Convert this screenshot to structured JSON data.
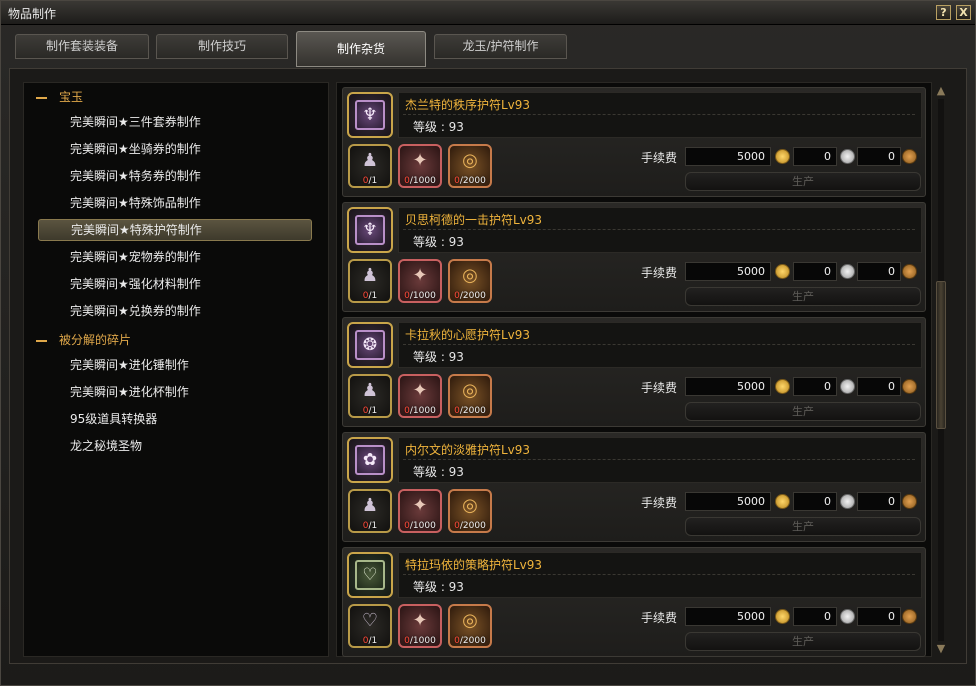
{
  "window": {
    "title": "物品制作",
    "help_label": "?",
    "close_label": "X"
  },
  "tabs": [
    {
      "label": "制作套装装备"
    },
    {
      "label": "制作技巧"
    },
    {
      "label": "制作杂货"
    },
    {
      "label": "龙玉/护符制作"
    }
  ],
  "active_tab": "制作杂货",
  "categories": [
    {
      "label": "宝玉",
      "expanded": true,
      "items": [
        "完美瞬间★三件套券制作",
        "完美瞬间★坐骑券的制作",
        "完美瞬间★特务券的制作",
        "完美瞬间★特殊饰品制作",
        "完美瞬间★特殊护符制作",
        "完美瞬间★宠物券的制作",
        "完美瞬间★强化材料制作",
        "完美瞬间★兑换券的制作"
      ]
    },
    {
      "label": "被分解的碎片",
      "expanded": true,
      "items": [
        "完美瞬间★进化锤制作",
        "完美瞬间★进化杯制作",
        "95级道具转换器",
        "龙之秘境圣物"
      ]
    }
  ],
  "selected_item": "完美瞬间★特殊护符制作",
  "fee_label": "手续费",
  "produce_label": "生产",
  "recipes": [
    {
      "name": "杰兰特的秩序护符Lv93",
      "level": "等级 : 93",
      "icon": "purple-sword-charm-icon",
      "materials": [
        {
          "icon": "dark-charm-material-icon",
          "have": "0",
          "need": "/1"
        },
        {
          "icon": "red-fragment-material-icon",
          "have": "0",
          "need": "/1000"
        },
        {
          "icon": "gold-ring-material-icon",
          "have": "0",
          "need": "/2000"
        }
      ],
      "fee_gold": "5000",
      "fee_silver": "0",
      "fee_bronze": "0"
    },
    {
      "name": "贝思柯德的一击护符Lv93",
      "level": "等级 : 93",
      "icon": "purple-sword-charm-icon",
      "materials": [
        {
          "icon": "dark-charm-material-icon",
          "have": "0",
          "need": "/1"
        },
        {
          "icon": "red-fragment-material-icon",
          "have": "0",
          "need": "/1000"
        },
        {
          "icon": "gold-ring-material-icon",
          "have": "0",
          "need": "/2000"
        }
      ],
      "fee_gold": "5000",
      "fee_silver": "0",
      "fee_bronze": "0"
    },
    {
      "name": "卡拉秋的心愿护符Lv93",
      "level": "等级 : 93",
      "icon": "purple-wish-charm-icon",
      "materials": [
        {
          "icon": "dark-charm-material-icon",
          "have": "0",
          "need": "/1"
        },
        {
          "icon": "red-fragment-material-icon",
          "have": "0",
          "need": "/1000"
        },
        {
          "icon": "gold-ring-material-icon",
          "have": "0",
          "need": "/2000"
        }
      ],
      "fee_gold": "5000",
      "fee_silver": "0",
      "fee_bronze": "0"
    },
    {
      "name": "内尔文的淡雅护符Lv93",
      "level": "等级 : 93",
      "icon": "purple-elegance-charm-icon",
      "materials": [
        {
          "icon": "dark-charm-material-icon",
          "have": "0",
          "need": "/1"
        },
        {
          "icon": "red-fragment-material-icon",
          "have": "0",
          "need": "/1000"
        },
        {
          "icon": "gold-ring-material-icon",
          "have": "0",
          "need": "/2000"
        }
      ],
      "fee_gold": "5000",
      "fee_silver": "0",
      "fee_bronze": "0"
    },
    {
      "name": "特拉玛依的策略护符Lv93",
      "level": "等级 : 93",
      "icon": "green-heart-charm-icon",
      "materials": [
        {
          "icon": "green-heart-material-icon",
          "have": "0",
          "need": "/1"
        },
        {
          "icon": "red-fragment-material-icon",
          "have": "0",
          "need": "/1000"
        },
        {
          "icon": "gold-ring-material-icon",
          "have": "0",
          "need": "/2000"
        }
      ],
      "fee_gold": "5000",
      "fee_silver": "0",
      "fee_bronze": "0"
    }
  ],
  "scroll": {
    "up_icon": "scroll-up-icon",
    "down_icon": "scroll-down-icon"
  }
}
